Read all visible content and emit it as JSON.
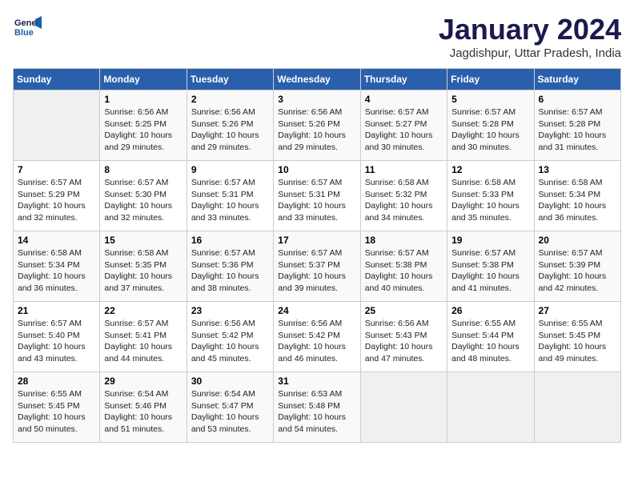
{
  "header": {
    "logo_line1": "General",
    "logo_line2": "Blue",
    "month_year": "January 2024",
    "location": "Jagdishpur, Uttar Pradesh, India"
  },
  "weekdays": [
    "Sunday",
    "Monday",
    "Tuesday",
    "Wednesday",
    "Thursday",
    "Friday",
    "Saturday"
  ],
  "weeks": [
    [
      {
        "day": "",
        "info": ""
      },
      {
        "day": "1",
        "info": "Sunrise: 6:56 AM\nSunset: 5:25 PM\nDaylight: 10 hours\nand 29 minutes."
      },
      {
        "day": "2",
        "info": "Sunrise: 6:56 AM\nSunset: 5:26 PM\nDaylight: 10 hours\nand 29 minutes."
      },
      {
        "day": "3",
        "info": "Sunrise: 6:56 AM\nSunset: 5:26 PM\nDaylight: 10 hours\nand 29 minutes."
      },
      {
        "day": "4",
        "info": "Sunrise: 6:57 AM\nSunset: 5:27 PM\nDaylight: 10 hours\nand 30 minutes."
      },
      {
        "day": "5",
        "info": "Sunrise: 6:57 AM\nSunset: 5:28 PM\nDaylight: 10 hours\nand 30 minutes."
      },
      {
        "day": "6",
        "info": "Sunrise: 6:57 AM\nSunset: 5:28 PM\nDaylight: 10 hours\nand 31 minutes."
      }
    ],
    [
      {
        "day": "7",
        "info": "Sunrise: 6:57 AM\nSunset: 5:29 PM\nDaylight: 10 hours\nand 32 minutes."
      },
      {
        "day": "8",
        "info": "Sunrise: 6:57 AM\nSunset: 5:30 PM\nDaylight: 10 hours\nand 32 minutes."
      },
      {
        "day": "9",
        "info": "Sunrise: 6:57 AM\nSunset: 5:31 PM\nDaylight: 10 hours\nand 33 minutes."
      },
      {
        "day": "10",
        "info": "Sunrise: 6:57 AM\nSunset: 5:31 PM\nDaylight: 10 hours\nand 33 minutes."
      },
      {
        "day": "11",
        "info": "Sunrise: 6:58 AM\nSunset: 5:32 PM\nDaylight: 10 hours\nand 34 minutes."
      },
      {
        "day": "12",
        "info": "Sunrise: 6:58 AM\nSunset: 5:33 PM\nDaylight: 10 hours\nand 35 minutes."
      },
      {
        "day": "13",
        "info": "Sunrise: 6:58 AM\nSunset: 5:34 PM\nDaylight: 10 hours\nand 36 minutes."
      }
    ],
    [
      {
        "day": "14",
        "info": "Sunrise: 6:58 AM\nSunset: 5:34 PM\nDaylight: 10 hours\nand 36 minutes."
      },
      {
        "day": "15",
        "info": "Sunrise: 6:58 AM\nSunset: 5:35 PM\nDaylight: 10 hours\nand 37 minutes."
      },
      {
        "day": "16",
        "info": "Sunrise: 6:57 AM\nSunset: 5:36 PM\nDaylight: 10 hours\nand 38 minutes."
      },
      {
        "day": "17",
        "info": "Sunrise: 6:57 AM\nSunset: 5:37 PM\nDaylight: 10 hours\nand 39 minutes."
      },
      {
        "day": "18",
        "info": "Sunrise: 6:57 AM\nSunset: 5:38 PM\nDaylight: 10 hours\nand 40 minutes."
      },
      {
        "day": "19",
        "info": "Sunrise: 6:57 AM\nSunset: 5:38 PM\nDaylight: 10 hours\nand 41 minutes."
      },
      {
        "day": "20",
        "info": "Sunrise: 6:57 AM\nSunset: 5:39 PM\nDaylight: 10 hours\nand 42 minutes."
      }
    ],
    [
      {
        "day": "21",
        "info": "Sunrise: 6:57 AM\nSunset: 5:40 PM\nDaylight: 10 hours\nand 43 minutes."
      },
      {
        "day": "22",
        "info": "Sunrise: 6:57 AM\nSunset: 5:41 PM\nDaylight: 10 hours\nand 44 minutes."
      },
      {
        "day": "23",
        "info": "Sunrise: 6:56 AM\nSunset: 5:42 PM\nDaylight: 10 hours\nand 45 minutes."
      },
      {
        "day": "24",
        "info": "Sunrise: 6:56 AM\nSunset: 5:42 PM\nDaylight: 10 hours\nand 46 minutes."
      },
      {
        "day": "25",
        "info": "Sunrise: 6:56 AM\nSunset: 5:43 PM\nDaylight: 10 hours\nand 47 minutes."
      },
      {
        "day": "26",
        "info": "Sunrise: 6:55 AM\nSunset: 5:44 PM\nDaylight: 10 hours\nand 48 minutes."
      },
      {
        "day": "27",
        "info": "Sunrise: 6:55 AM\nSunset: 5:45 PM\nDaylight: 10 hours\nand 49 minutes."
      }
    ],
    [
      {
        "day": "28",
        "info": "Sunrise: 6:55 AM\nSunset: 5:45 PM\nDaylight: 10 hours\nand 50 minutes."
      },
      {
        "day": "29",
        "info": "Sunrise: 6:54 AM\nSunset: 5:46 PM\nDaylight: 10 hours\nand 51 minutes."
      },
      {
        "day": "30",
        "info": "Sunrise: 6:54 AM\nSunset: 5:47 PM\nDaylight: 10 hours\nand 53 minutes."
      },
      {
        "day": "31",
        "info": "Sunrise: 6:53 AM\nSunset: 5:48 PM\nDaylight: 10 hours\nand 54 minutes."
      },
      {
        "day": "",
        "info": ""
      },
      {
        "day": "",
        "info": ""
      },
      {
        "day": "",
        "info": ""
      }
    ]
  ]
}
